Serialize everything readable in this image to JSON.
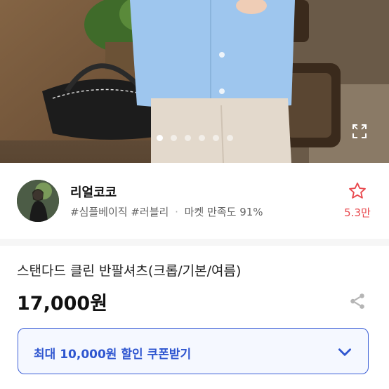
{
  "carousel": {
    "total_images": 6,
    "active_index": 0
  },
  "seller": {
    "name": "리얼코코",
    "tag_1": "#심플베이직",
    "tag_2": "#러블리",
    "separator": "·",
    "satisfaction": "마켓 만족도 91%",
    "like_count": "5.3만"
  },
  "product": {
    "title": "스탠다드 클린 반팔셔츠(크롭/기본/여름)",
    "price": "17,000원"
  },
  "coupon": {
    "label": "최대 10,000원 할인 쿠폰받기"
  },
  "icons": {
    "expand": "expand-icon",
    "star": "star-outline-icon",
    "share": "share-icon",
    "chevron": "chevron-down-icon"
  },
  "colors": {
    "accent_blue": "#2f56d0",
    "like_red": "#e8474c",
    "coupon_bg": "#f5f8ff"
  }
}
